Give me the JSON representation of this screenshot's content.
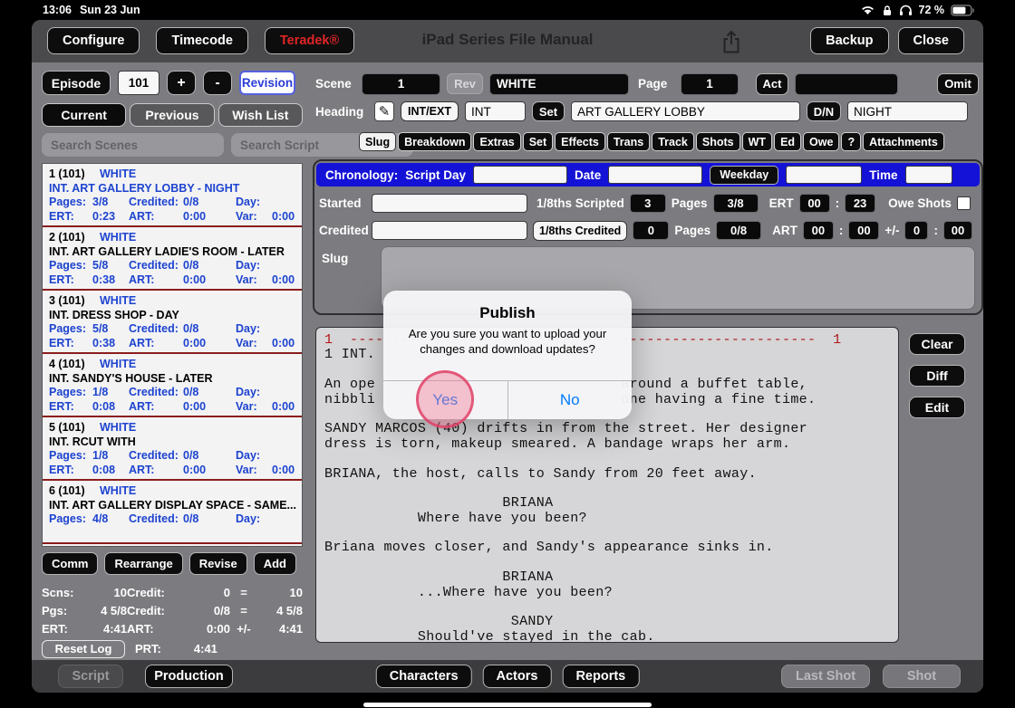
{
  "status_bar": {
    "time": "13:06",
    "date": "Sun 23 Jun",
    "battery": "72 %"
  },
  "top_toolbar": {
    "configure": "Configure",
    "timecode": "Timecode",
    "teradek": "Teradek®",
    "title": "iPad Series File Manual",
    "backup": "Backup",
    "close": "Close"
  },
  "icons": {
    "heading_edit": "✎"
  },
  "sidebar": {
    "episode_label": "Episode",
    "episode_number": "101",
    "plus": "+",
    "minus": "-",
    "revision": "Revision",
    "tabs": [
      "Current",
      "Previous",
      "Wish List"
    ],
    "active_tab": "Current",
    "search_scenes_placeholder": "Search Scenes",
    "search_script_placeholder": "Search Script",
    "scene_labels": {
      "pages": "Pages:",
      "credited": "Credited:",
      "day": "Day:",
      "ert": "ERT:",
      "art": "ART:",
      "var": "Var:"
    },
    "scenes": [
      {
        "number": "1 (101)",
        "color": "WHITE",
        "heading": "INT. ART GALLERY LOBBY - NIGHT",
        "selected": true,
        "pages": "3/8",
        "credited": "0/8",
        "day": "",
        "ert": "0:23",
        "art": "0:00",
        "var": "0:00"
      },
      {
        "number": "2 (101)",
        "color": "WHITE",
        "heading": "INT. ART GALLERY LADIE'S ROOM - LATER",
        "selected": false,
        "pages": "5/8",
        "credited": "0/8",
        "day": "",
        "ert": "0:38",
        "art": "0:00",
        "var": "0:00"
      },
      {
        "number": "3 (101)",
        "color": "WHITE",
        "heading": "INT. DRESS SHOP - DAY",
        "selected": false,
        "pages": "5/8",
        "credited": "0/8",
        "day": "",
        "ert": "0:38",
        "art": "0:00",
        "var": "0:00"
      },
      {
        "number": "4 (101)",
        "color": "WHITE",
        "heading": "INT. SANDY'S HOUSE - LATER",
        "selected": false,
        "pages": "1/8",
        "credited": "0/8",
        "day": "",
        "ert": "0:08",
        "art": "0:00",
        "var": "0:00"
      },
      {
        "number": "5 (101)",
        "color": "WHITE",
        "heading": "INT. RCUT WITH",
        "selected": false,
        "pages": "1/8",
        "credited": "0/8",
        "day": "",
        "ert": "0:08",
        "art": "0:00",
        "var": "0:00"
      },
      {
        "number": "6 (101)",
        "color": "WHITE",
        "heading": "INT. ART GALLERY DISPLAY SPACE - SAME...",
        "selected": false,
        "pages": "4/8",
        "credited": "0/8",
        "day": ""
      }
    ],
    "actions": [
      "Comm",
      "Rearrange",
      "Revise",
      "Add"
    ],
    "totals": {
      "rows": [
        {
          "l1": "Scns:",
          "v1": "10",
          "l2": "Credit:",
          "v2": "0",
          "op": "=",
          "v3": "10"
        },
        {
          "l1": "Pgs:",
          "v1": "4 5/8",
          "l2": "Credit:",
          "v2": "0/8",
          "op": "=",
          "v3": "4 5/8"
        },
        {
          "l1": "ERT:",
          "v1": "4:41",
          "l2": "ART:",
          "v2": "0:00",
          "op": "+/-",
          "v3": "4:41"
        }
      ],
      "reset_log": "Reset Log",
      "prt_label": "PRT:",
      "prt_value": "4:41"
    }
  },
  "scene_panel": {
    "scene_label": "Scene",
    "scene_number": "1",
    "rev": "Rev",
    "scene_color": "WHITE",
    "page_label": "Page",
    "page_number": "1",
    "act": "Act",
    "act_value": "",
    "omit": "Omit",
    "heading_label": "Heading",
    "int_ext": "INT/EXT",
    "int_ext_value": "INT",
    "set_label": "Set",
    "set_value": "ART GALLERY LOBBY",
    "dn_label": "D/N",
    "dn_value": "NIGHT",
    "tabs": [
      "Slug",
      "Breakdown",
      "Extras",
      "Set",
      "Effects",
      "Trans",
      "Track",
      "Shots",
      "WT",
      "Ed",
      "Owe",
      "?",
      "Attachments"
    ],
    "active_tab": "Slug",
    "colon": ":",
    "chronology": {
      "label": "Chronology:",
      "script_day_label": "Script Day",
      "script_day": "",
      "date_label": "Date",
      "date": "",
      "weekday": "Weekday",
      "weekday_value": "",
      "time_label": "Time",
      "time": ""
    },
    "started": {
      "label": "Started",
      "value": "",
      "scripted_label": "1/8ths Scripted",
      "scripted": "3",
      "pages_label": "Pages",
      "pages": "3/8",
      "ert_label": "ERT",
      "ert_h": "00",
      "ert_m": "23",
      "owe_shots_label": "Owe Shots"
    },
    "credited": {
      "label": "Credited",
      "value": "",
      "credited_label": "1/8ths Credited",
      "credited": "0",
      "pages_label": "Pages",
      "pages": "0/8",
      "art_label": "ART",
      "art_h": "00",
      "art_m": "00",
      "plus_minus": "+/-",
      "pm_h": "0",
      "pm_m": "00"
    },
    "slug_label": "Slug",
    "side_buttons": [
      "Clear",
      "Diff",
      "Edit"
    ]
  },
  "script_preview": {
    "lines": [
      {
        "ruler": true,
        "left": "1",
        "right": "1",
        "dashCol": 3,
        "dashCount": 55,
        "rightCol": 60,
        "red": true
      },
      {
        "t": "1 INT."
      },
      {
        "t": ""
      },
      {
        "t": "An ope",
        "right": "around a buffet table,",
        "rightCol": 35
      },
      {
        "t": "nibbli",
        "right": "one having a fine time.",
        "rightCol": 35
      },
      {
        "t": ""
      },
      {
        "t": "SANDY MARCOS (40) drifts in from the street. Her designer"
      },
      {
        "t": "dress is torn, makeup smeared. A bandage wraps her arm."
      },
      {
        "t": ""
      },
      {
        "t": "BRIANA, the host, calls to Sandy from 20 feet away."
      },
      {
        "t": ""
      },
      {
        "t": "BRIANA",
        "pad": 21
      },
      {
        "t": "Where have you been?",
        "pad": 11
      },
      {
        "t": ""
      },
      {
        "t": "Briana moves closer, and Sandy's appearance sinks in."
      },
      {
        "t": ""
      },
      {
        "t": "BRIANA",
        "pad": 21
      },
      {
        "t": "...Where have you been?",
        "pad": 11
      },
      {
        "t": ""
      },
      {
        "t": "SANDY",
        "pad": 22
      },
      {
        "t": "Should've stayed in the cab.",
        "pad": 11
      }
    ]
  },
  "dialog": {
    "title": "Publish",
    "message": "Are you sure you want to upload your changes and download updates?",
    "yes": "Yes",
    "no": "No"
  },
  "bottom_toolbar": {
    "script": "Script",
    "production": "Production",
    "characters": "Characters",
    "actors": "Actors",
    "reports": "Reports",
    "last_shot": "Last Shot",
    "shot": "Shot"
  },
  "colors": {
    "chronology_bar_blue": "#1412d6",
    "sidebar_link_blue": "#1d43cf",
    "alert_action_blue": "#007aff",
    "teradek_red": "#e02525",
    "script_ruler_red": "#b01515",
    "scene_separator_red": "#8b1d1d",
    "tap_indicator_pink": "#e85a84"
  }
}
